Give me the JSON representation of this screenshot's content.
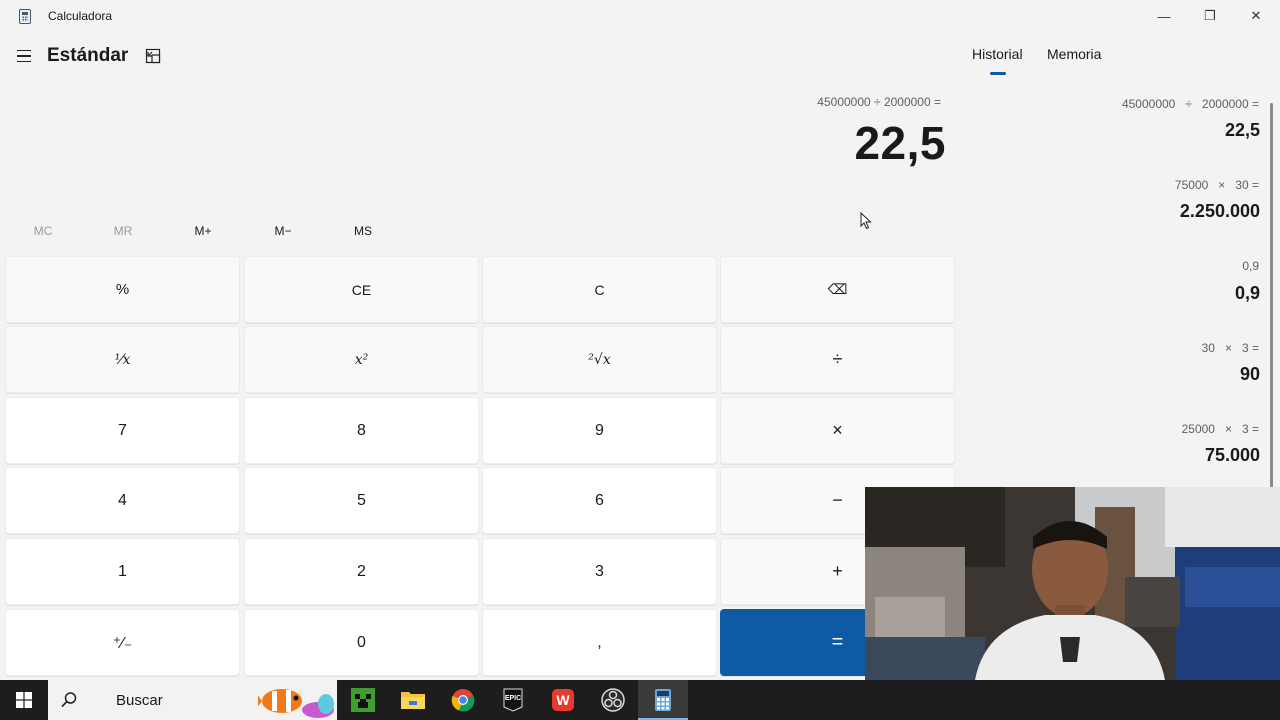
{
  "window": {
    "title": "Calculadora",
    "minimize_glyph": "—",
    "restore_glyph": "❐",
    "close_glyph": "✕"
  },
  "header": {
    "mode": "Estándar"
  },
  "display": {
    "expression": "45000000 ÷ 2000000 =",
    "result": "22,5"
  },
  "memory": {
    "mc": "MC",
    "mr": "MR",
    "mplus": "M+",
    "mminus": "M−",
    "ms": "MS"
  },
  "keys": {
    "percent": "%",
    "ce": "CE",
    "c": "C",
    "backspace": "⌫",
    "reciprocal": "¹⁄x",
    "square": "x²",
    "sqrt": "²√x",
    "divide": "÷",
    "k7": "7",
    "k8": "8",
    "k9": "9",
    "multiply": "×",
    "k4": "4",
    "k5": "5",
    "k6": "6",
    "minus": "−",
    "k1": "1",
    "k2": "2",
    "k3": "3",
    "plus": "+",
    "negate": "⁺∕₋",
    "k0": "0",
    "decimal": ",",
    "equals": "="
  },
  "side_panel": {
    "tabs": [
      {
        "label": "Historial",
        "active": true
      },
      {
        "label": "Memoria",
        "active": false
      }
    ],
    "history": [
      {
        "expression": "45000000   ÷   2000000 =",
        "result": "22,5"
      },
      {
        "expression": "75000   ×   30 =",
        "result": "2.250.000"
      },
      {
        "expression": "0,9",
        "result": "0,9"
      },
      {
        "expression": "30   ×   3 =",
        "result": "90"
      },
      {
        "expression": "25000   ×   3 =",
        "result": "75.000"
      }
    ]
  },
  "taskbar": {
    "search_label": "Buscar",
    "apps": [
      "minecraft-icon",
      "file-explorer-icon",
      "chrome-icon",
      "epic-games-icon",
      "wps-office-icon",
      "obs-icon",
      "calculator-icon"
    ],
    "epic_label": "EPIC",
    "wps_label": "W"
  },
  "colors": {
    "accent": "#0f5aa4",
    "background": "#f3f3f3",
    "taskbar": "#1d1d1d"
  }
}
